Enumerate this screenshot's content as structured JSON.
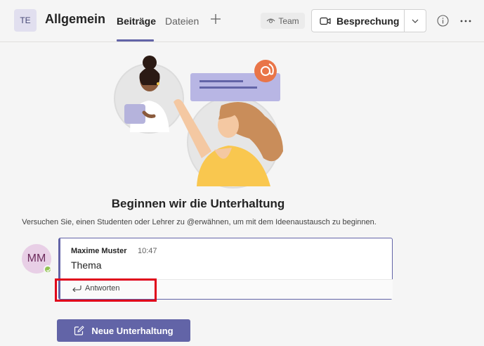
{
  "header": {
    "team_initials": "TE",
    "channel_name": "Allgemein",
    "tabs": [
      {
        "label": "Beiträge",
        "active": true
      },
      {
        "label": "Dateien",
        "active": false
      }
    ],
    "team_label": "Team",
    "meeting_label": "Besprechung"
  },
  "empty_state": {
    "title": "Beginnen wir die Unterhaltung",
    "subtitle": "Versuchen Sie, einen Studenten oder Lehrer zu @erwähnen, um mit dem Ideenaustausch zu beginnen."
  },
  "message": {
    "author_initials": "MM",
    "author": "Maxime Muster",
    "time": "10:47",
    "body": "Thema",
    "reply_label": "Antworten"
  },
  "new_conversation_label": "Neue Unterhaltung",
  "colors": {
    "accent": "#6264a7",
    "highlight": "#e0001a",
    "presence": "#92c353"
  }
}
